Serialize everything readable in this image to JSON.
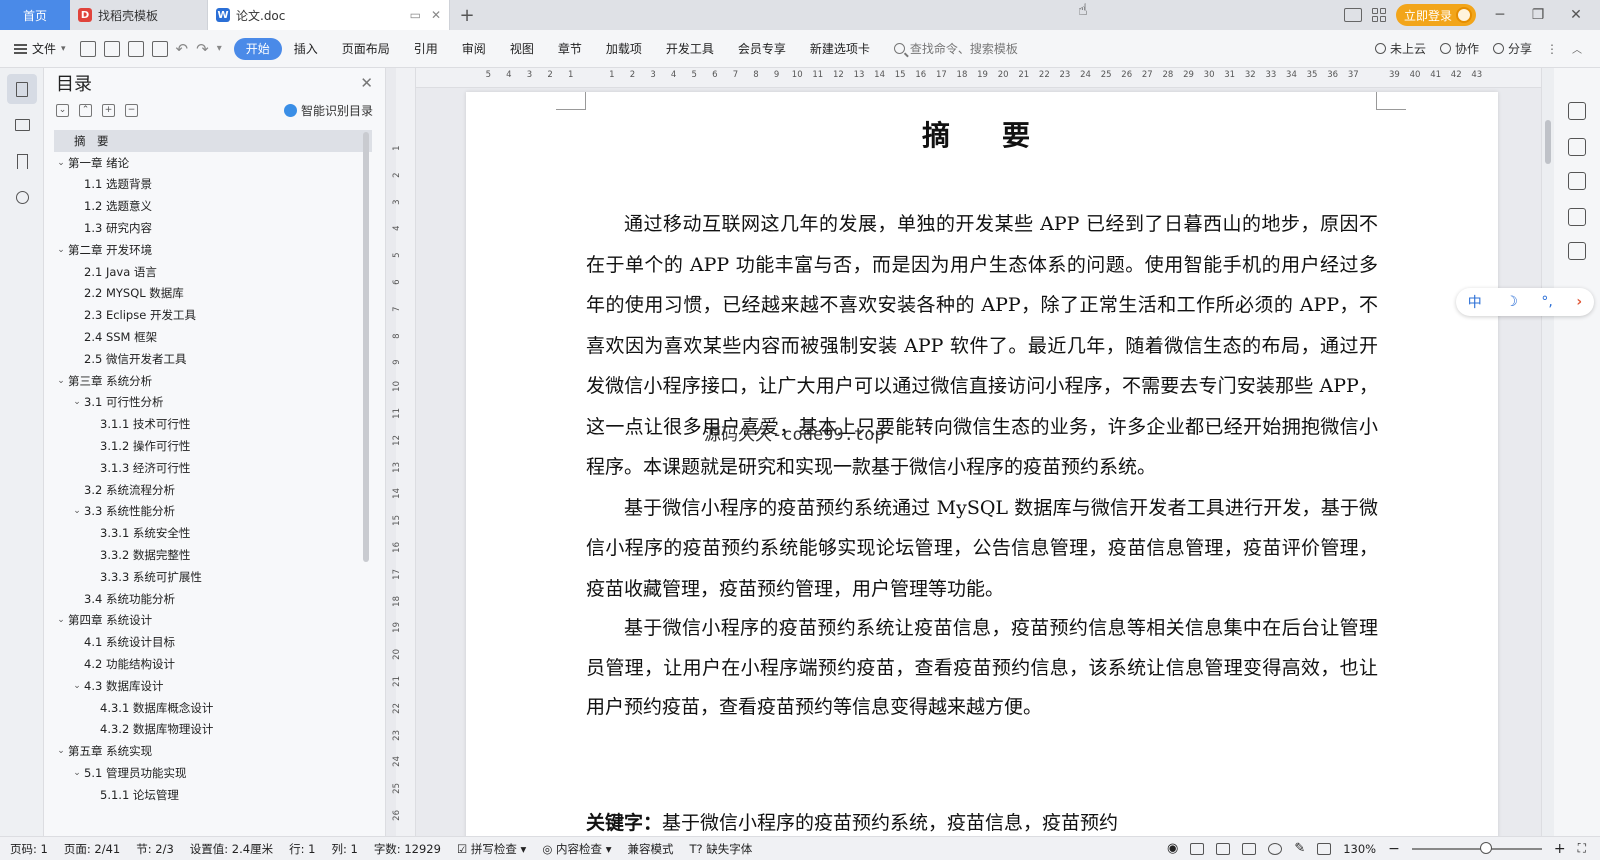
{
  "tabbar": {
    "home_label": "首页",
    "tabs": [
      {
        "label": "找稻壳模板",
        "logo": "D"
      },
      {
        "label": "论文.doc",
        "logo": "W"
      }
    ],
    "login_label": "立即登录"
  },
  "menubar": {
    "file_label": "文件",
    "tabs": [
      "开始",
      "插入",
      "页面布局",
      "引用",
      "审阅",
      "视图",
      "章节",
      "加载项",
      "开发工具",
      "会员专享",
      "新建选项卡"
    ],
    "active_tab": "开始",
    "search_placeholder": "查找命令、搜索模板",
    "right_items": [
      "未上云",
      "协作",
      "分享"
    ]
  },
  "toc": {
    "title": "目录",
    "smart_label": "智能识别目录",
    "items": [
      {
        "label": "摘　要",
        "level": 0,
        "arrow": "",
        "selected": true
      },
      {
        "label": "第一章  绪论",
        "level": 0,
        "arrow": "v"
      },
      {
        "label": "1.1  选题背景",
        "level": 1,
        "arrow": ""
      },
      {
        "label": "1.2  选题意义",
        "level": 1,
        "arrow": ""
      },
      {
        "label": "1.3  研究内容",
        "level": 1,
        "arrow": ""
      },
      {
        "label": "第二章  开发环境",
        "level": 0,
        "arrow": "v"
      },
      {
        "label": "2.1 Java 语言",
        "level": 1,
        "arrow": ""
      },
      {
        "label": "2.2 MYSQL 数据库",
        "level": 1,
        "arrow": ""
      },
      {
        "label": "2.3 Eclipse 开发工具",
        "level": 1,
        "arrow": ""
      },
      {
        "label": "2.4 SSM 框架",
        "level": 1,
        "arrow": ""
      },
      {
        "label": "2.5 微信开发者工具",
        "level": 1,
        "arrow": ""
      },
      {
        "label": "第三章  系统分析",
        "level": 0,
        "arrow": "v"
      },
      {
        "label": "3.1 可行性分析",
        "level": 1,
        "arrow": "v"
      },
      {
        "label": "3.1.1 技术可行性",
        "level": 2,
        "arrow": ""
      },
      {
        "label": "3.1.2 操作可行性",
        "level": 2,
        "arrow": ""
      },
      {
        "label": "3.1.3 经济可行性",
        "level": 2,
        "arrow": ""
      },
      {
        "label": "3.2 系统流程分析",
        "level": 1,
        "arrow": ""
      },
      {
        "label": "3.3 系统性能分析",
        "level": 1,
        "arrow": "v"
      },
      {
        "label": "3.3.1 系统安全性",
        "level": 2,
        "arrow": ""
      },
      {
        "label": "3.3.2 数据完整性",
        "level": 2,
        "arrow": ""
      },
      {
        "label": "3.3.3 系统可扩展性",
        "level": 2,
        "arrow": ""
      },
      {
        "label": "3.4 系统功能分析",
        "level": 1,
        "arrow": ""
      },
      {
        "label": "第四章  系统设计",
        "level": 0,
        "arrow": "v"
      },
      {
        "label": "4.1  系统设计目标",
        "level": 1,
        "arrow": ""
      },
      {
        "label": "4.2 功能结构设计",
        "level": 1,
        "arrow": ""
      },
      {
        "label": "4.3 数据库设计",
        "level": 1,
        "arrow": "v"
      },
      {
        "label": "4.3.1  数据库概念设计",
        "level": 2,
        "arrow": ""
      },
      {
        "label": "4.3.2  数据库物理设计",
        "level": 2,
        "arrow": ""
      },
      {
        "label": "第五章  系统实现",
        "level": 0,
        "arrow": "v"
      },
      {
        "label": "5.1 管理员功能实现",
        "level": 1,
        "arrow": "v"
      },
      {
        "label": "5.1.1  论坛管理",
        "level": 2,
        "arrow": ""
      }
    ]
  },
  "document": {
    "title": "摘　要",
    "paragraphs": [
      "通过移动互联网这几年的发展，单独的开发某些 APP 已经到了日暮西山的地步，原因不在于单个的 APP 功能丰富与否，而是因为用户生态体系的问题。使用智能手机的用户经过多年的使用习惯，已经越来越不喜欢安装各种的 APP，除了正常生活和工作所必须的 APP，不喜欢因为喜欢某些内容而被强制安装 APP 软件了。最近几年，随着微信生态的布局，通过开发微信小程序接口，让广大用户可以通过微信直接访问小程序，不需要去专门安装那些 APP，这一点让很多用户喜爱，基本上只要能转向微信生态的业务，许多企业都已经开始拥抱微信小程序。本课题就是研究和实现一款基于微信小程序的疫苗预约系统。",
      "基于微信小程序的疫苗预约系统通过 MySQL 数据库与微信开发者工具进行开发，基于微信小程序的疫苗预约系统能够实现论坛管理，公告信息管理，疫苗信息管理，疫苗评价管理，疫苗收藏管理，疫苗预约管理，用户管理等功能。",
      "基于微信小程序的疫苗预约系统让疫苗信息，疫苗预约信息等相关信息集中在后台让管理员管理，让用户在小程序端预约疫苗，查看疫苗预约信息，该系统让信息管理变得高效，也让用户预约疫苗，查看疫苗预约等信息变得越来越方便。"
    ],
    "keywords_label": "关键字：",
    "keywords": "基于微信小程序的疫苗预约系统，疫苗信息，疫苗预约",
    "watermark": "源码久久-code99.top"
  },
  "ruler": {
    "h_marks": [
      "5",
      "4",
      "3",
      "2",
      "1",
      "",
      "1",
      "2",
      "3",
      "4",
      "5",
      "6",
      "7",
      "8",
      "9",
      "10",
      "11",
      "12",
      "13",
      "14",
      "15",
      "16",
      "17",
      "18",
      "19",
      "20",
      "21",
      "22",
      "23",
      "24",
      "25",
      "26",
      "27",
      "28",
      "29",
      "30",
      "31",
      "32",
      "33",
      "34",
      "35",
      "36",
      "37",
      "",
      "39",
      "40",
      "41",
      "42",
      "43"
    ],
    "v_marks": [
      "1",
      "2",
      "3",
      "4",
      "5",
      "6",
      "7",
      "8",
      "9",
      "10",
      "11",
      "12",
      "13",
      "14",
      "15",
      "16",
      "17",
      "18",
      "19",
      "20",
      "21",
      "22",
      "23",
      "24",
      "25",
      "26"
    ]
  },
  "ime": {
    "lang": "中",
    "moon": "☽",
    "punct": "°,",
    "arrow": "›"
  },
  "statusbar": {
    "page_no": "页码: 1",
    "page": "页面: 2/41",
    "section": "节: 2/3",
    "setting": "设置值: 2.4厘米",
    "row": "行: 1",
    "col": "列: 1",
    "word_count": "字数: 12929",
    "spell_check": "拼写检查",
    "content_check": "内容检查",
    "compat_mode": "兼容模式",
    "missing_font": "缺失字体",
    "zoom": "130%"
  },
  "colors": {
    "accent": "#4a8ae8",
    "login": "#f2a51a"
  }
}
